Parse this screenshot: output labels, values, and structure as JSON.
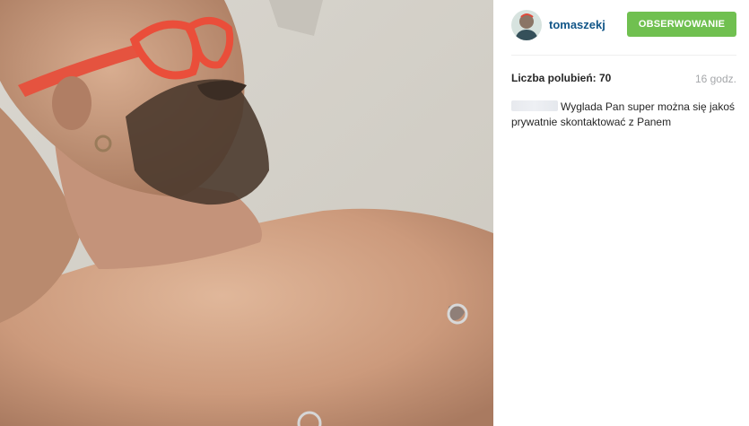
{
  "post": {
    "username": "tomaszekj",
    "follow_button_label": "OBSERWOWANIE",
    "likes_text": "Liczba polubień: 70",
    "time_text": "16 godz."
  },
  "comments": [
    {
      "author": "",
      "text": "Wyglada Pan super można się jakoś prywatnie skontaktować z Panem"
    }
  ],
  "colors": {
    "username": "#125688",
    "follow_button": "#70c050",
    "text": "#262626",
    "muted": "#a5a7aa"
  },
  "icons": {
    "avatar": "profile-avatar"
  }
}
